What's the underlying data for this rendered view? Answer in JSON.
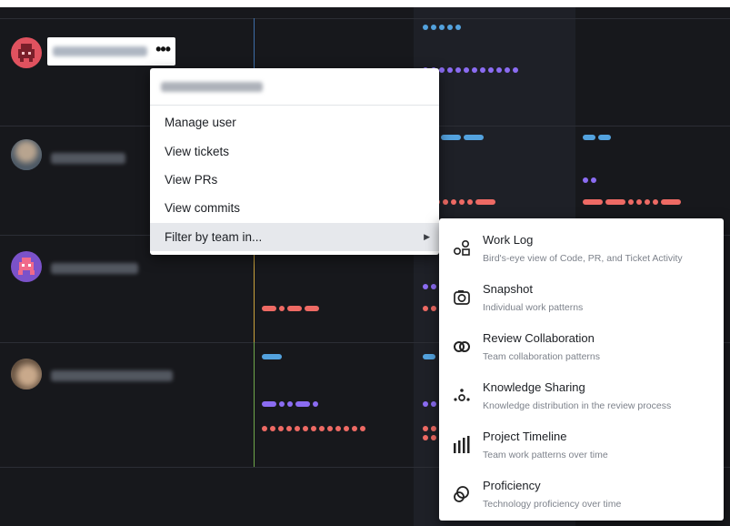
{
  "context_menu": {
    "items": [
      {
        "label": "Manage user"
      },
      {
        "label": "View tickets"
      },
      {
        "label": "View PRs"
      },
      {
        "label": "View commits"
      },
      {
        "label": "Filter by team in...",
        "has_submenu": true
      }
    ]
  },
  "submenu": {
    "items": [
      {
        "title": "Work Log",
        "subtitle": "Bird's-eye view of Code, PR, and Ticket Activity",
        "icon": "work-log-icon"
      },
      {
        "title": "Snapshot",
        "subtitle": "Individual work patterns",
        "icon": "camera-icon"
      },
      {
        "title": "Review Collaboration",
        "subtitle": "Team collaboration patterns",
        "icon": "interlocking-rings-icon"
      },
      {
        "title": "Knowledge Sharing",
        "subtitle": "Knowledge distribution in the review process",
        "icon": "dots-network-icon"
      },
      {
        "title": "Project Timeline",
        "subtitle": "Team work patterns over time",
        "icon": "bar-timeline-icon"
      },
      {
        "title": "Proficiency",
        "subtitle": "Technology proficiency over time",
        "icon": "overlapping-circles-icon"
      }
    ]
  },
  "colors": {
    "background": "#17181c",
    "activity_blue": "#53a2de",
    "activity_purple": "#8b6cf2",
    "activity_red": "#ee6a64",
    "menu_bg": "#ffffff",
    "menu_highlight": "#e6e8ec"
  }
}
